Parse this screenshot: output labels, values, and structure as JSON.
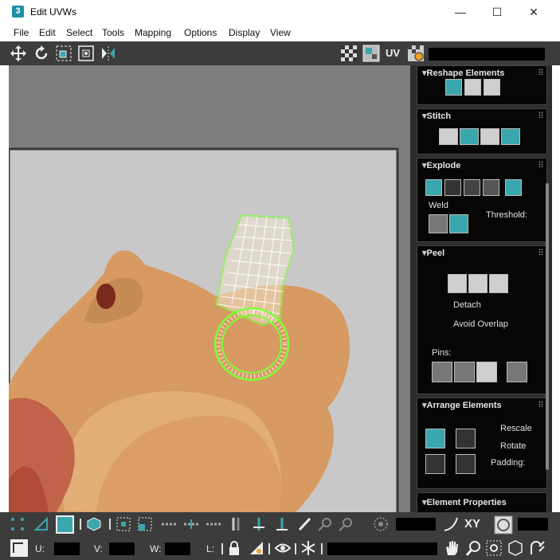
{
  "window": {
    "title": "Edit UVWs",
    "app_icon_text": "3",
    "minimize": "—",
    "maximize": "☐",
    "close": "✕"
  },
  "menu": [
    "File",
    "Edit",
    "Select",
    "Tools",
    "Mapping",
    "Options",
    "Display",
    "View"
  ],
  "toolbar": {
    "uv_label": "UV"
  },
  "panel": {
    "reshape": {
      "title": "Reshape Elements"
    },
    "stitch": {
      "title": "Stitch"
    },
    "explode": {
      "title": "Explode",
      "weld": "Weld",
      "threshold": "Threshold:"
    },
    "peel": {
      "title": "Peel",
      "detach": "Detach",
      "avoid_overlap": "Avoid Overlap",
      "pins": "Pins:"
    },
    "arrange": {
      "title": "Arrange Elements",
      "rescale": "Rescale",
      "rotate": "Rotate",
      "padding": "Padding:"
    },
    "element_props": {
      "title": "Element Properties"
    }
  },
  "status": {
    "u_label": "U:",
    "v_label": "V:",
    "w_label": "W:",
    "l_label": "L:",
    "xy_label": "XY"
  },
  "colors": {
    "accent": "#3aa6ad",
    "panel_bg": "#2d2d2d",
    "toolbar_bg": "#3c3c3c",
    "uv_wire": "#7dff3a"
  }
}
